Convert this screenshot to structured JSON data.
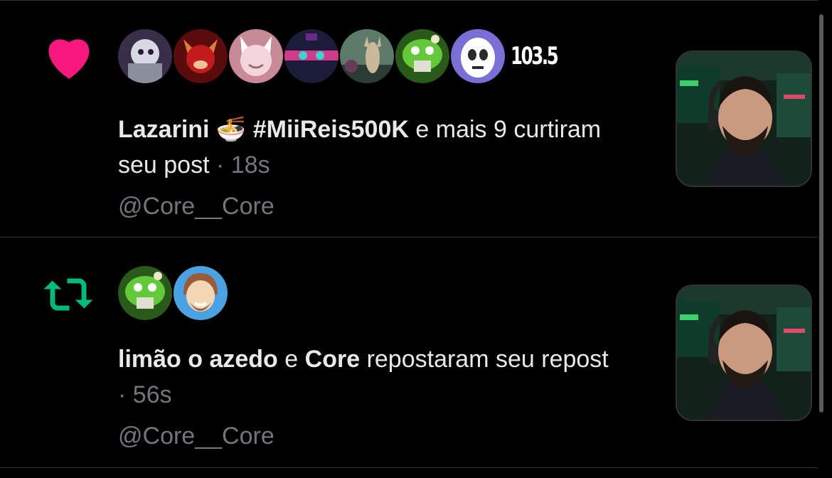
{
  "notifications": [
    {
      "type_icon": "heart-icon",
      "avatars": [
        {
          "colors": [
            "#8a8f9c",
            "#d9d9e6",
            "#3b2d4f"
          ]
        },
        {
          "colors": [
            "#c21b1b",
            "#e07a3a",
            "#4a0c0c"
          ]
        },
        {
          "colors": [
            "#f2d6dc",
            "#ffffff",
            "#9b6b78"
          ]
        },
        {
          "colors": [
            "#1b1b3a",
            "#d23a8a",
            "#3fd0d0"
          ]
        },
        {
          "colors": [
            "#5b7a6a",
            "#c9b89a",
            "#2c3b33"
          ]
        },
        {
          "colors": [
            "#63c93b",
            "#a9ee6a",
            "#2a5a1a"
          ]
        },
        {
          "colors": [
            "#7a6fd6",
            "#ffffff",
            "#2a2a2a"
          ]
        }
      ],
      "extra_count": "103.5",
      "user1": "Lazarini 🍜 #MiiReis500K",
      "connector": "e mais 9",
      "action": "curtiram seu post",
      "dot": "·",
      "time": "18s",
      "handle": "@Core__Core"
    },
    {
      "type_icon": "repost-icon",
      "avatars": [
        {
          "colors": [
            "#63c93b",
            "#a9ee6a",
            "#2a5a1a"
          ]
        },
        {
          "colors": [
            "#4aa3e0",
            "#9b5a3a",
            "#f3d7b5"
          ]
        }
      ],
      "user1": "limão o azedo",
      "connector": "e",
      "user2": "Core",
      "action": "repostaram seu repost",
      "dot": "·",
      "time": "56s",
      "handle": "@Core__Core"
    }
  ],
  "colors": {
    "like": "#f91880",
    "repost": "#00ba7c",
    "muted": "#71767b",
    "text": "#e7e9ea"
  }
}
